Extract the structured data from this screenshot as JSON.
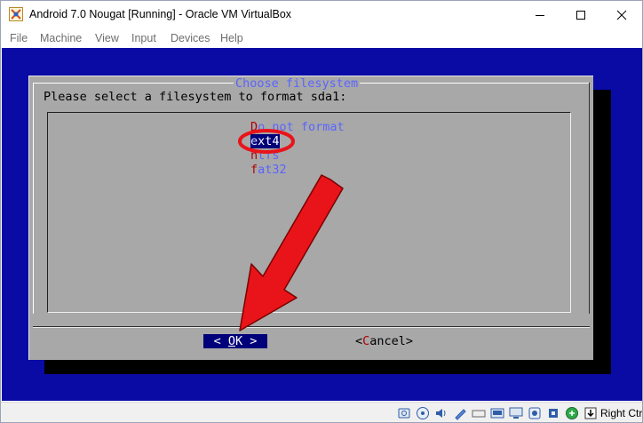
{
  "window": {
    "title": "Android 7.0 Nougat [Running] - Oracle VM VirtualBox"
  },
  "menu": [
    "File",
    "Machine",
    "View",
    "Input",
    "Devices",
    "Help"
  ],
  "dialog": {
    "title": "Choose filesystem",
    "prompt": "Please select a filesystem to format sda1:",
    "options": [
      {
        "hot": "D",
        "rest": "o not format",
        "selected": false
      },
      {
        "hot": "e",
        "rest": "xt4",
        "selected": true
      },
      {
        "hot": "n",
        "rest": "tfs",
        "selected": false
      },
      {
        "hot": "f",
        "rest": "at32",
        "selected": false
      }
    ],
    "ok_button": {
      "left": "< ",
      "key": "O",
      "rest": "K",
      "right": " >"
    },
    "cancel_button": {
      "left": "<",
      "key": "C",
      "rest": "ancel",
      "right": ">"
    }
  },
  "statusbar": {
    "host_key": "Right Ctrl",
    "icons": [
      "hard-disk-icon",
      "optical-drive-icon",
      "audio-icon",
      "network-icon",
      "usb-icon",
      "shared-folder-icon",
      "display-icon",
      "video-capture-icon",
      "cpu-icon",
      "mouse-integration-icon",
      "keyboard-capture-icon"
    ]
  },
  "colors": {
    "vm_background": "#0a0aa5",
    "dialog_background": "#a8a8a8",
    "title_blue": "#5a64ff",
    "selected_bg": "#00007a",
    "annotation_red": "#e8141a"
  }
}
